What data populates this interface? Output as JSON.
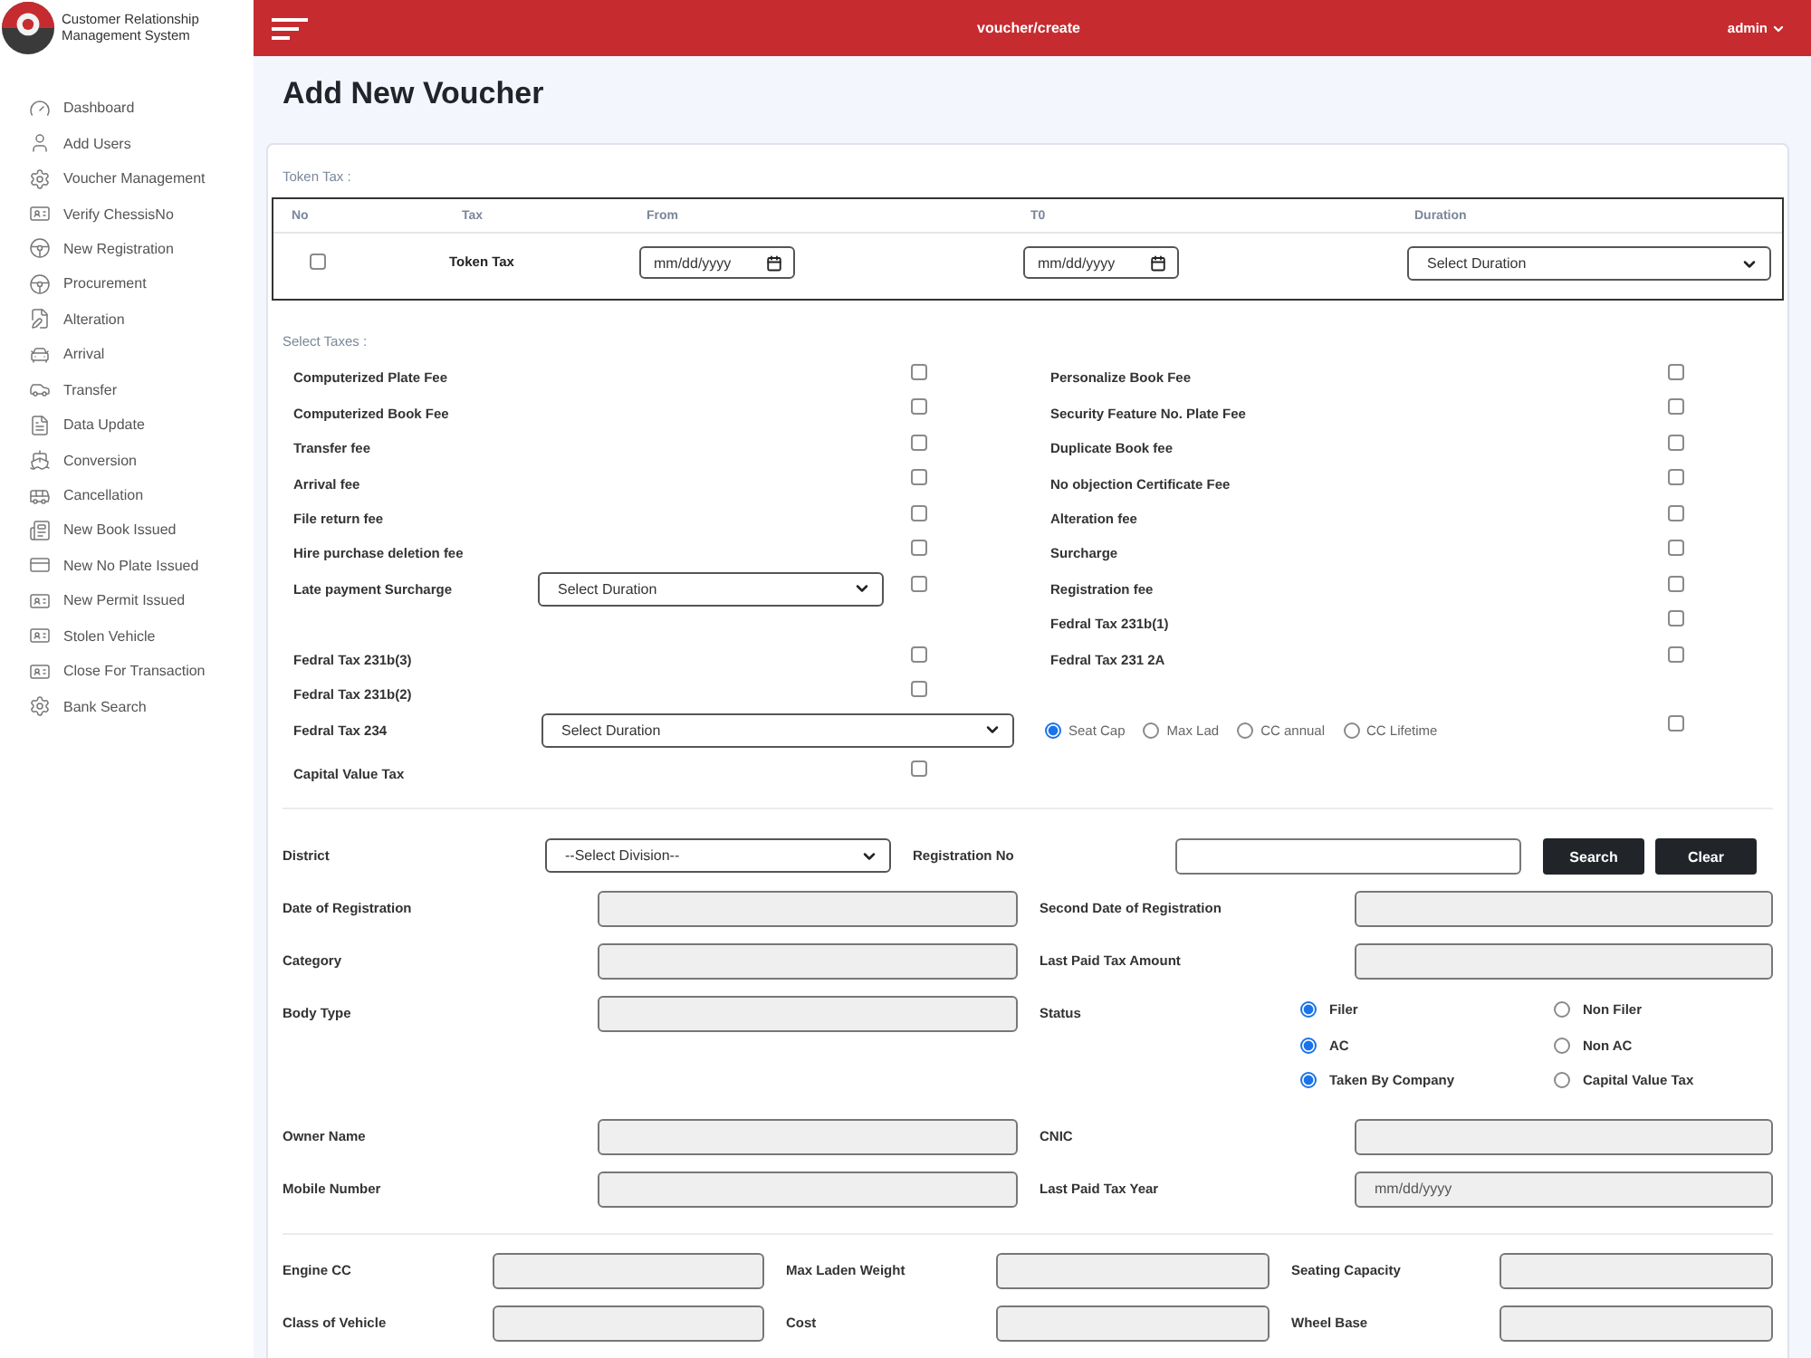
{
  "sidebar": {
    "title": "Customer Relationship Management System",
    "items": [
      {
        "label": "Dashboard",
        "selected": false
      },
      {
        "label": "Add Users",
        "selected": false
      },
      {
        "label": "Voucher Management",
        "selected": false
      },
      {
        "label": "Verify ChessisNo",
        "selected": false
      },
      {
        "label": "New Registration",
        "selected": false
      },
      {
        "label": "Procurement",
        "selected": false
      },
      {
        "label": "Alteration",
        "selected": false
      },
      {
        "label": "Arrival",
        "selected": false
      },
      {
        "label": "Transfer",
        "selected": false
      },
      {
        "label": "Data Update",
        "selected": false
      },
      {
        "label": "Conversion",
        "selected": false
      },
      {
        "label": "Cancellation",
        "selected": false
      },
      {
        "label": "New Book Issued",
        "selected": false
      },
      {
        "label": "New No Plate Issued",
        "selected": false
      },
      {
        "label": "New Permit Issued",
        "selected": false
      },
      {
        "label": "Stolen Vehicle",
        "selected": false
      },
      {
        "label": "Close For Transaction",
        "selected": false
      },
      {
        "label": "Bank Search",
        "selected": false
      }
    ]
  },
  "header": {
    "path": "voucher/create",
    "user": "admin"
  },
  "page_title": "Add New Voucher",
  "token_tax": {
    "label": "Token Tax :",
    "columns": [
      "No",
      "Tax",
      "From",
      "T0",
      "Duration"
    ],
    "rows": [
      {
        "checked": false,
        "tax": "Token Tax",
        "from": {
          "placeholder": "mm/dd/yyyy"
        },
        "to": {
          "placeholder": "mm/dd/yyyy"
        },
        "duration": "Select Duration"
      }
    ]
  },
  "select_taxes": {
    "label": "Select Taxes :",
    "columns": [
      {
        "groups": [
          {
            "items": [
              {
                "kind": "checkbox",
                "label": "Computerized Plate Fee",
                "checked": false
              },
              {
                "kind": "checkbox",
                "label": "Computerized Book Fee",
                "checked": false
              },
              {
                "kind": "checkbox",
                "label": "Transfer fee",
                "checked": false
              },
              {
                "kind": "checkbox",
                "label": "Arrival fee",
                "checked": false
              },
              {
                "kind": "checkbox",
                "label": "File return fee",
                "checked": false
              },
              {
                "kind": "checkbox",
                "label": "Hire purchase deletion fee",
                "checked": false
              },
              {
                "kind": "select_checkbox",
                "label": "Late payment Surcharge",
                "select": "Select Duration",
                "checked": false
              }
            ]
          },
          {
            "items": [
              {
                "kind": "checkbox",
                "label": "Fedral Tax 231b(3)",
                "checked": false
              },
              {
                "kind": "checkbox",
                "label": "Fedral Tax 231b(2)",
                "checked": false
              },
              {
                "kind": "select",
                "label": "Fedral Tax 234",
                "select": "Select Duration"
              },
              {
                "kind": "checkbox",
                "label": "Capital Value Tax",
                "checked": false
              }
            ]
          }
        ]
      },
      {
        "groups": [
          {
            "items": [
              {
                "kind": "checkbox",
                "label": "Personalize Book Fee",
                "checked": false
              },
              {
                "kind": "checkbox",
                "label": "Security Feature No. Plate Fee",
                "checked": false
              },
              {
                "kind": "checkbox",
                "label": "Duplicate Book fee",
                "checked": false
              },
              {
                "kind": "checkbox",
                "label": "No objection Certificate Fee",
                "checked": false
              },
              {
                "kind": "checkbox",
                "label": "Alteration fee",
                "checked": false
              },
              {
                "kind": "checkbox",
                "label": "Surcharge",
                "checked": false
              },
              {
                "kind": "checkbox",
                "label": "Registration fee",
                "checked": false
              },
              {
                "kind": "checkbox",
                "label": "Fedral Tax 231b(1)",
                "checked": false
              },
              {
                "kind": "checkbox",
                "label": "Fedral Tax 231 2A",
                "checked": false
              }
            ]
          },
          {
            "items": [
              {
                "kind": "radios",
                "options": [
                  {
                    "label": "Seat Cap",
                    "selected": true
                  },
                  {
                    "label": "Max Lad",
                    "selected": false
                  },
                  {
                    "label": "CC annual",
                    "selected": false
                  },
                  {
                    "label": "CC Lifetime",
                    "selected": false
                  }
                ],
                "checked": false
              }
            ]
          }
        ]
      }
    ]
  },
  "vehicle_search": {
    "district": {
      "label": "District",
      "select": "--Select Division--"
    },
    "registration_no": {
      "label": "Registration No"
    },
    "buttons": [
      "Search",
      "Clear"
    ]
  },
  "owner_details": {
    "fields": [
      {
        "kind": "text",
        "label": "Date of Registration"
      },
      {
        "kind": "text",
        "label": "Second Date of Registration"
      },
      {
        "kind": "text",
        "label": "Category"
      },
      {
        "kind": "text",
        "label": "Last Paid Tax Amount"
      },
      {
        "kind": "text",
        "label": "Body Type"
      },
      {
        "kind": "radios",
        "label": "Status",
        "groups": [
          {
            "options": [
              {
                "label": "Filer",
                "selected": true
              },
              {
                "label": "Non Filer",
                "selected": false
              }
            ]
          },
          {
            "options": [
              {
                "label": "AC",
                "selected": true
              },
              {
                "label": "Non AC",
                "selected": false
              }
            ]
          },
          {
            "options": [
              {
                "label": "Taken By Company",
                "selected": true
              },
              {
                "label": "Capital Value Tax",
                "selected": false
              }
            ]
          }
        ]
      },
      {
        "kind": "text",
        "label": "Owner Name"
      },
      {
        "kind": "text",
        "label": "CNIC"
      },
      {
        "kind": "text",
        "label": "Mobile Number"
      },
      {
        "kind": "date",
        "label": "Last Paid Tax Year",
        "placeholder": "mm/dd/yyyy"
      }
    ]
  },
  "vehicle_details": {
    "fields": [
      {
        "label": "Engine CC"
      },
      {
        "label": "Max Laden Weight"
      },
      {
        "label": "Seating Capacity"
      },
      {
        "label": "Class of Vehicle"
      },
      {
        "label": "Cost"
      },
      {
        "label": "Wheel Base"
      }
    ]
  }
}
